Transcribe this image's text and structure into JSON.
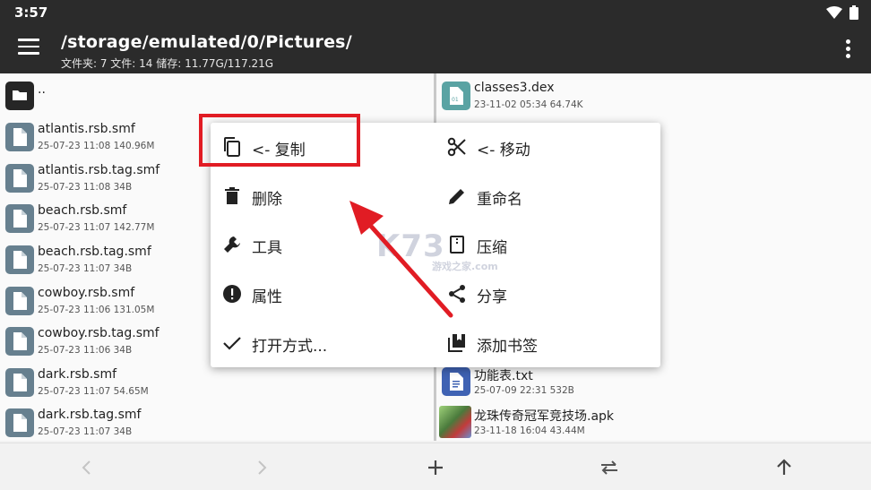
{
  "status": {
    "time": "3:57"
  },
  "appbar": {
    "path": "/storage/emulated/0/Pictures/",
    "summary": "文件夹: 7  文件: 14  储存: 11.77G/117.21G"
  },
  "left_pane": {
    "parent_label": "..",
    "files": [
      {
        "name": "atlantis.rsb.smf",
        "meta": "25-07-23 11:08  140.96M"
      },
      {
        "name": "atlantis.rsb.tag.smf",
        "meta": "25-07-23 11:08  34B"
      },
      {
        "name": "beach.rsb.smf",
        "meta": "25-07-23 11:07  142.77M"
      },
      {
        "name": "beach.rsb.tag.smf",
        "meta": "25-07-23 11:07  34B"
      },
      {
        "name": "cowboy.rsb.smf",
        "meta": "25-07-23 11:06  131.05M"
      },
      {
        "name": "cowboy.rsb.tag.smf",
        "meta": "25-07-23 11:06  34B"
      },
      {
        "name": "dark.rsb.smf",
        "meta": "25-07-23 11:07  54.65M"
      },
      {
        "name": "dark.rsb.tag.smf",
        "meta": "25-07-23 11:07  34B"
      }
    ]
  },
  "right_pane": {
    "files": [
      {
        "name": "classes3.dex",
        "meta": "23-11-02 05:34  64.74K",
        "icon": "dex-file-icon"
      },
      {
        "name": "功能表.txt",
        "meta": "25-07-09 22:31  532B",
        "icon": "txt-file-icon"
      },
      {
        "name": "龙珠传奇冠军竞技场.apk",
        "meta": "23-11-18 16:04  43.44M",
        "icon": "apk-file-icon"
      }
    ]
  },
  "context_menu": {
    "copy": "<- 复制",
    "move": "<- 移动",
    "delete": "删除",
    "rename": "重命名",
    "tools": "工具",
    "compress": "压缩",
    "properties": "属性",
    "share": "分享",
    "open_with": "打开方式...",
    "bookmark": "添加书签"
  },
  "watermark": {
    "main": "K73",
    "sub": "游戏之家",
    "domain": ".com"
  },
  "colors": {
    "appbar": "#2b2b2b",
    "highlight": "#e11c24",
    "menu_bg": "#ffffff"
  }
}
